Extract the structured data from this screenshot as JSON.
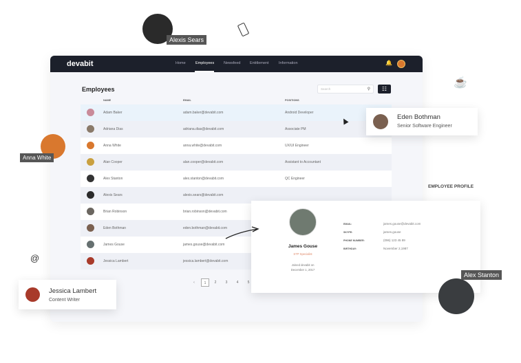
{
  "nav": {
    "logo": "devabit",
    "items": [
      "Home",
      "Employees",
      "Newsfeed",
      "Entitlement",
      "Information"
    ],
    "active": "Employees"
  },
  "page": {
    "title": "Employees",
    "search_placeholder": "Search",
    "columns": [
      "NAME",
      "EMAIL",
      "POSITIONS"
    ]
  },
  "rows": [
    {
      "name": "Adam Baker",
      "email": "adam.baker@devabit.com",
      "position": "Android Developer",
      "color": "#c98b9a"
    },
    {
      "name": "Adriana Dias",
      "email": "adriana.dias@devabit.com",
      "position": "Associate PM",
      "color": "#8a7a6a"
    },
    {
      "name": "Anna White",
      "email": "anna.white@devabit.com",
      "position": "UX/UI Engineer",
      "color": "#d9782e"
    },
    {
      "name": "Alan Cooper",
      "email": "alan.cooper@devabit.com",
      "position": "Assistant to Accountant",
      "color": "#c9a040"
    },
    {
      "name": "Alex Stanton",
      "email": "alex.stanton@devabit.com",
      "position": "QC Engineer",
      "color": "#333"
    },
    {
      "name": "Alexis Sears",
      "email": "alexis.sears@devabit.com",
      "position": "",
      "color": "#2a2a2a"
    },
    {
      "name": "Brian Robinson",
      "email": "brian.robinson@devabit.com",
      "position": "",
      "color": "#6b6660"
    },
    {
      "name": "Eden Bothman",
      "email": "eden.bothman@devabit.com",
      "position": "",
      "color": "#7a6050"
    },
    {
      "name": "James Gouse",
      "email": "james.gouse@devabit.com",
      "position": "",
      "color": "#667070"
    },
    {
      "name": "Jessica Lambert",
      "email": "jessica.lambert@devabit.com",
      "position": "",
      "color": "#a83a2a"
    }
  ],
  "pagination": {
    "prev": "‹",
    "pages": [
      "1",
      "2",
      "3",
      "4",
      "5"
    ],
    "current": "1"
  },
  "profile": {
    "heading": "EMPLOYEE PROFILE",
    "name": "James Gouse",
    "role": "STP Specialist",
    "joined_line1": "Joined devabit on",
    "joined_line2": "December 1, 2017",
    "fields": [
      {
        "label": "EMAIL:",
        "value": "james.gouse@devabit.com"
      },
      {
        "label": "SKYPE:",
        "value": "james.gouse"
      },
      {
        "label": "PHONE NUMBER:",
        "value": "(096) 123 45 89"
      },
      {
        "label": "BIRTHDAY:",
        "value": "November 2,1987"
      }
    ]
  },
  "floating": {
    "eden": {
      "name": "Eden Bothman",
      "role": "Senior Software Engineer"
    },
    "jessica": {
      "name": "Jessica Lambert",
      "role": "Content Writer"
    },
    "alexis": "Alexis Sears",
    "anna": "Anna White",
    "alex": "Alex Stanton"
  },
  "colors": {
    "nav": "#1c202b",
    "accent_role": "#e08a6a"
  }
}
